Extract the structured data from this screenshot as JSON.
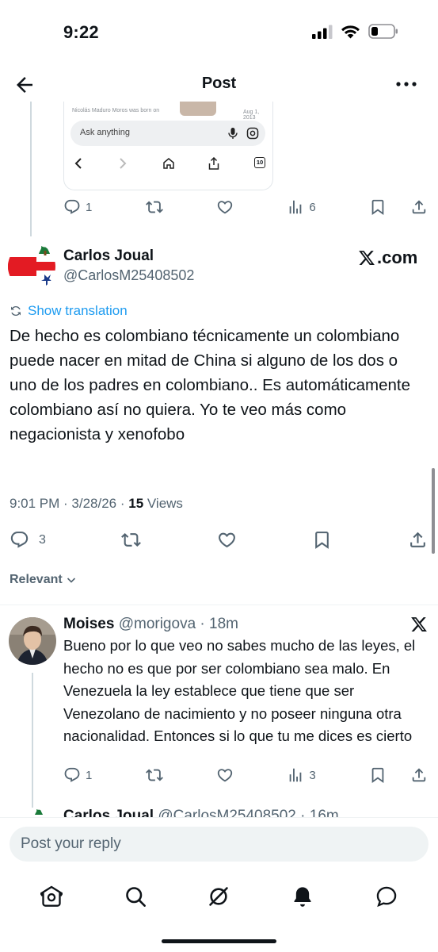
{
  "status_bar": {
    "time": "9:22"
  },
  "header": {
    "title": "Post"
  },
  "quoted_card": {
    "snippet": "Nicolás Maduro Moros was born on",
    "date": "Aug 1, 2013",
    "ask_placeholder": "Ask anything",
    "tab_count": "10"
  },
  "prev_tweet_actions": {
    "replies": "1",
    "retweets": "",
    "likes": "",
    "views": "6"
  },
  "main_tweet": {
    "name": "Carlos Joual",
    "handle": "@CarlosM25408502",
    "source_badge": ".com",
    "translate_label": "Show translation",
    "text": "De hecho es colombiano técnicamente un colombiano puede nacer en mitad de China si alguno de los dos o uno de los padres en colombiano.. Es automáticamente colombiano así no quiera. Yo te veo más como negacionista y xenofobo",
    "time": "9:01 PM · 3/28/26 · ",
    "views_count": "15",
    "views_label": " Views",
    "actions": {
      "replies": "3"
    }
  },
  "sort_filter": {
    "label": "Relevant"
  },
  "reply": {
    "name": "Moises",
    "handle": " @morigova",
    "time": " · 18m",
    "text": "Bueno por lo que veo no sabes mucho de las leyes, el hecho no es que por ser colombiano sea malo. En Venezuela la ley establece que tiene que ser Venezolano de nacimiento y no poseer ninguna otra nacionalidad. Entonces si lo que tu me dices es cierto",
    "actions": {
      "replies": "1",
      "views": "3"
    }
  },
  "next_reply_peek": {
    "name": "Carlos Joual",
    "handle": " @CarlosM25408502",
    "time": " · 16m"
  },
  "composer": {
    "placeholder": "Post your reply"
  },
  "bottom_nav": [
    "home",
    "search",
    "grok",
    "notifications",
    "messages"
  ],
  "colors": {
    "accent": "#1d9bf0",
    "secondary_text": "#536471",
    "text": "#0f1419"
  }
}
